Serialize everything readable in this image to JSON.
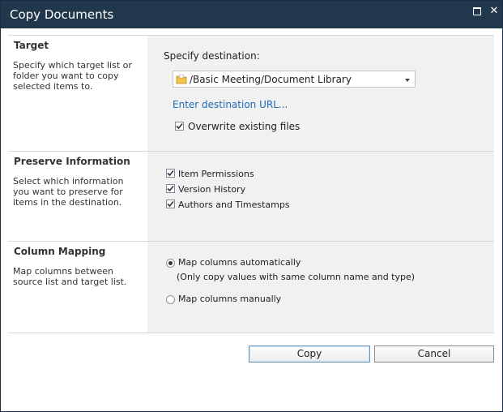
{
  "dialog": {
    "title": "Copy Documents"
  },
  "target": {
    "heading": "Target",
    "description": "Specify which target list or folder you want to copy selected items to.",
    "specify_label": "Specify destination:",
    "destination_value": "/Basic Meeting/Document Library",
    "link_text": "Enter destination URL...",
    "overwrite_label": "Overwrite existing files",
    "overwrite_checked": true
  },
  "preserve": {
    "heading": "Preserve Information",
    "description": "Select which information you want to preserve for items in the destination.",
    "options": [
      {
        "label": "Item Permissions",
        "checked": true
      },
      {
        "label": "Version History",
        "checked": true
      },
      {
        "label": "Authors and Timestamps",
        "checked": true
      }
    ]
  },
  "mapping": {
    "heading": "Column Mapping",
    "description": "Map columns between source list and target list.",
    "auto_label": "Map columns automatically",
    "auto_note": "(Only copy values with same column name and type)",
    "manual_label": "Map columns manually",
    "selected": "auto"
  },
  "actions": {
    "copy_label": "Copy",
    "cancel_label": "Cancel"
  }
}
